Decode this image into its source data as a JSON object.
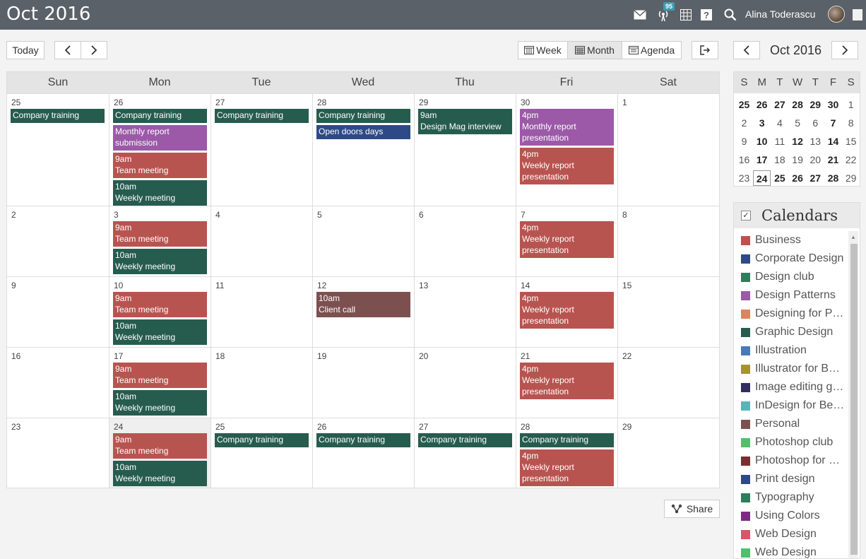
{
  "header": {
    "title": "Oct 2016",
    "notification_count": "95",
    "user_name": "Alina Toderascu"
  },
  "toolbar": {
    "today": "Today",
    "views": [
      "Week",
      "Month",
      "Agenda"
    ],
    "active_view": "Month",
    "share": "Share"
  },
  "weekdays": [
    "Sun",
    "Mon",
    "Tue",
    "Wed",
    "Thu",
    "Fri",
    "Sat"
  ],
  "weeks": [
    {
      "days": [
        {
          "num": "25",
          "events": [
            {
              "text": "Company training",
              "color": "#265c4e"
            }
          ]
        },
        {
          "num": "26",
          "events": [
            {
              "text": "Company training",
              "color": "#265c4e"
            },
            {
              "text": "Monthly report submission",
              "color": "#9b59a8"
            },
            {
              "text": "9am\nTeam meeting",
              "color": "#b85450"
            },
            {
              "text": "10am\nWeekly meeting",
              "color": "#265c4e"
            }
          ]
        },
        {
          "num": "27",
          "events": [
            {
              "text": "Company training",
              "color": "#265c4e"
            }
          ]
        },
        {
          "num": "28",
          "events": [
            {
              "text": "Company training",
              "color": "#265c4e"
            },
            {
              "text": "Open doors days",
              "color": "#2e4a86"
            }
          ]
        },
        {
          "num": "29",
          "events": [
            {
              "text": "9am\nDesign Mag interview",
              "color": "#265c4e"
            }
          ]
        },
        {
          "num": "30",
          "events": [
            {
              "text": "4pm\nMonthly report presentation",
              "color": "#9b59a8"
            },
            {
              "text": "4pm\nWeekly report presentation",
              "color": "#b85450"
            }
          ]
        },
        {
          "num": "1",
          "events": []
        }
      ]
    },
    {
      "days": [
        {
          "num": "2",
          "events": []
        },
        {
          "num": "3",
          "events": [
            {
              "text": "9am\nTeam meeting",
              "color": "#b85450"
            },
            {
              "text": "10am\nWeekly meeting",
              "color": "#265c4e"
            }
          ]
        },
        {
          "num": "4",
          "events": []
        },
        {
          "num": "5",
          "events": []
        },
        {
          "num": "6",
          "events": []
        },
        {
          "num": "7",
          "events": [
            {
              "text": "4pm\nWeekly report presentation",
              "color": "#b85450"
            }
          ]
        },
        {
          "num": "8",
          "events": []
        }
      ]
    },
    {
      "days": [
        {
          "num": "9",
          "events": []
        },
        {
          "num": "10",
          "events": [
            {
              "text": "9am\nTeam meeting",
              "color": "#b85450"
            },
            {
              "text": "10am\nWeekly meeting",
              "color": "#265c4e"
            }
          ]
        },
        {
          "num": "11",
          "events": []
        },
        {
          "num": "12",
          "events": [
            {
              "text": "10am\nClient call",
              "color": "#7d5050"
            }
          ]
        },
        {
          "num": "13",
          "events": []
        },
        {
          "num": "14",
          "events": [
            {
              "text": "4pm\nWeekly report presentation",
              "color": "#b85450"
            }
          ]
        },
        {
          "num": "15",
          "events": []
        }
      ]
    },
    {
      "days": [
        {
          "num": "16",
          "events": []
        },
        {
          "num": "17",
          "events": [
            {
              "text": "9am\nTeam meeting",
              "color": "#b85450"
            },
            {
              "text": "10am\nWeekly meeting",
              "color": "#265c4e"
            }
          ]
        },
        {
          "num": "18",
          "events": []
        },
        {
          "num": "19",
          "events": []
        },
        {
          "num": "20",
          "events": []
        },
        {
          "num": "21",
          "events": [
            {
              "text": "4pm\nWeekly report presentation",
              "color": "#b85450"
            }
          ]
        },
        {
          "num": "22",
          "events": []
        }
      ]
    },
    {
      "days": [
        {
          "num": "23",
          "events": []
        },
        {
          "num": "24",
          "today": true,
          "events": [
            {
              "text": "9am\nTeam meeting",
              "color": "#b85450"
            },
            {
              "text": "10am\nWeekly meeting",
              "color": "#265c4e"
            }
          ]
        },
        {
          "num": "25",
          "events": [
            {
              "text": "Company training",
              "color": "#265c4e"
            }
          ]
        },
        {
          "num": "26",
          "events": [
            {
              "text": "Company training",
              "color": "#265c4e"
            }
          ]
        },
        {
          "num": "27",
          "events": [
            {
              "text": "Company training",
              "color": "#265c4e"
            }
          ]
        },
        {
          "num": "28",
          "events": [
            {
              "text": "Company training",
              "color": "#265c4e"
            },
            {
              "text": "4pm\nWeekly report presentation",
              "color": "#b85450"
            }
          ]
        },
        {
          "num": "29",
          "events": []
        }
      ]
    }
  ],
  "mini_calendar": {
    "title": "Oct 2016",
    "weekdays": [
      "S",
      "M",
      "T",
      "W",
      "T",
      "F",
      "S"
    ],
    "rows": [
      [
        {
          "d": "25",
          "b": true
        },
        {
          "d": "26",
          "b": true
        },
        {
          "d": "27",
          "b": true
        },
        {
          "d": "28",
          "b": true
        },
        {
          "d": "29",
          "b": true
        },
        {
          "d": "30",
          "b": true
        },
        {
          "d": "1"
        }
      ],
      [
        {
          "d": "2"
        },
        {
          "d": "3",
          "b": true
        },
        {
          "d": "4"
        },
        {
          "d": "5"
        },
        {
          "d": "6"
        },
        {
          "d": "7",
          "b": true
        },
        {
          "d": "8"
        }
      ],
      [
        {
          "d": "9"
        },
        {
          "d": "10",
          "b": true
        },
        {
          "d": "11"
        },
        {
          "d": "12",
          "b": true
        },
        {
          "d": "13"
        },
        {
          "d": "14",
          "b": true
        },
        {
          "d": "15"
        }
      ],
      [
        {
          "d": "16"
        },
        {
          "d": "17",
          "b": true
        },
        {
          "d": "18"
        },
        {
          "d": "19"
        },
        {
          "d": "20"
        },
        {
          "d": "21",
          "b": true
        },
        {
          "d": "22"
        }
      ],
      [
        {
          "d": "23"
        },
        {
          "d": "24",
          "b": true,
          "sel": true
        },
        {
          "d": "25",
          "b": true
        },
        {
          "d": "26",
          "b": true
        },
        {
          "d": "27",
          "b": true
        },
        {
          "d": "28",
          "b": true
        },
        {
          "d": "29"
        }
      ]
    ]
  },
  "calendars": {
    "title": "Calendars",
    "items": [
      {
        "label": "Business",
        "color": "#b85450"
      },
      {
        "label": "Corporate Design",
        "color": "#2e4a86"
      },
      {
        "label": "Design club",
        "color": "#2e7d5b"
      },
      {
        "label": "Design Patterns",
        "color": "#9b59a8"
      },
      {
        "label": "Designing for Print",
        "color": "#d98560"
      },
      {
        "label": "Graphic Design",
        "color": "#265c4e"
      },
      {
        "label": "Illustration",
        "color": "#4a7ab5"
      },
      {
        "label": "Illustrator for Beginners",
        "color": "#a89230"
      },
      {
        "label": "Image editing group",
        "color": "#322f5c"
      },
      {
        "label": "InDesign for Beginners",
        "color": "#57b5b8"
      },
      {
        "label": "Personal",
        "color": "#7d5050"
      },
      {
        "label": "Photoshop club",
        "color": "#4fc06b"
      },
      {
        "label": "Photoshop for Beginners",
        "color": "#7a2e2e"
      },
      {
        "label": "Print design",
        "color": "#2e4a86"
      },
      {
        "label": "Typography",
        "color": "#2e7d5b"
      },
      {
        "label": "Using Colors",
        "color": "#7a2e82"
      },
      {
        "label": "Web Design",
        "color": "#d9556c"
      },
      {
        "label": "Web Design",
        "color": "#4fc06b"
      }
    ]
  }
}
